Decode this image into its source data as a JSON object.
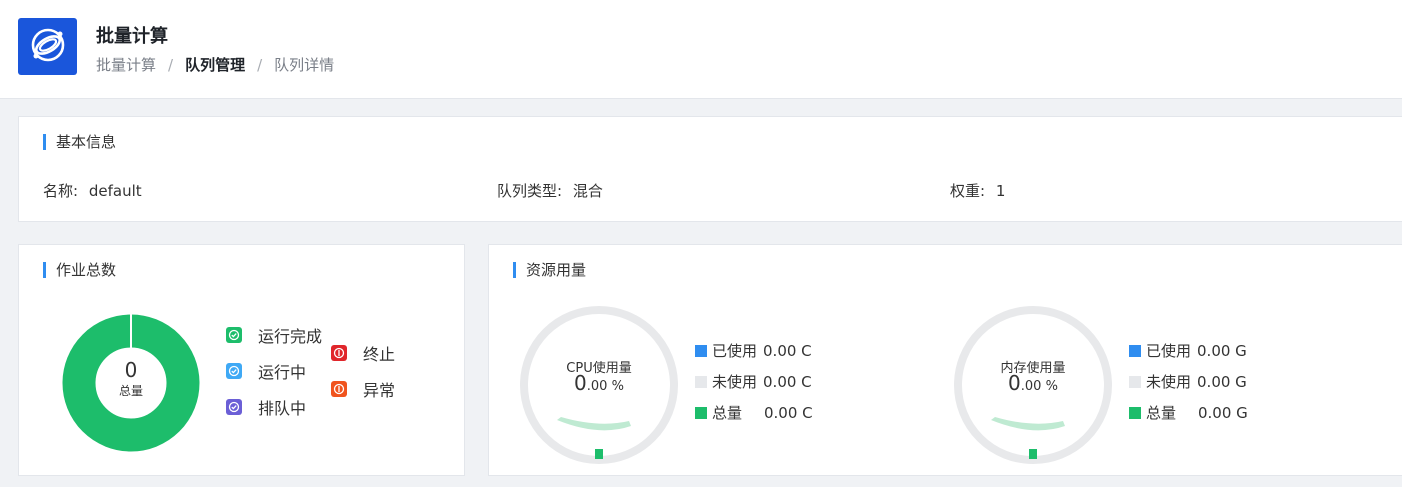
{
  "header": {
    "title": "批量计算",
    "breadcrumb": [
      "批量计算",
      "队列管理",
      "队列详情"
    ],
    "logo_icon": "satellite-logo-icon",
    "logo_color": "#1a56db"
  },
  "basic_info": {
    "section_title": "基本信息",
    "fields": [
      {
        "label": "名称:",
        "value": "default"
      },
      {
        "label": "队列类型:",
        "value": "混合"
      },
      {
        "label": "权重:",
        "value": "1"
      }
    ]
  },
  "jobs": {
    "section_title": "作业总数",
    "total_value": "0",
    "total_label": "总量",
    "donut_color": "#1dbd6b",
    "statuses": [
      {
        "label": "运行完成",
        "icon": "check-icon",
        "color": "#1dbd6b"
      },
      {
        "label": "运行中",
        "icon": "check-icon",
        "color": "#3fa9f5"
      },
      {
        "label": "排队中",
        "icon": "check-icon",
        "color": "#6b5fd6"
      },
      {
        "label": "终止",
        "icon": "stop-icon",
        "color": "#e0262b"
      },
      {
        "label": "异常",
        "icon": "stop-icon",
        "color": "#f0541e"
      }
    ]
  },
  "resources": {
    "section_title": "资源用量",
    "gauges": [
      {
        "title": "CPU使用量",
        "value": "0",
        "unit": ".00 %",
        "usage_fraction": 0,
        "legend": [
          {
            "label": "已使用",
            "value": "0.00 C",
            "color": "#2f8df0"
          },
          {
            "label": "未使用",
            "value": "0.00 C",
            "color": "#e6e8eb"
          },
          {
            "label": "总量",
            "value": "0.00 C",
            "color": "#1dbd6b"
          }
        ]
      },
      {
        "title": "内存使用量",
        "value": "0",
        "unit": ".00 %",
        "usage_fraction": 0,
        "legend": [
          {
            "label": "已使用",
            "value": "0.00 G",
            "color": "#2f8df0"
          },
          {
            "label": "未使用",
            "value": "0.00 G",
            "color": "#e6e8eb"
          },
          {
            "label": "总量",
            "value": "0.00 G",
            "color": "#1dbd6b"
          }
        ]
      }
    ]
  }
}
